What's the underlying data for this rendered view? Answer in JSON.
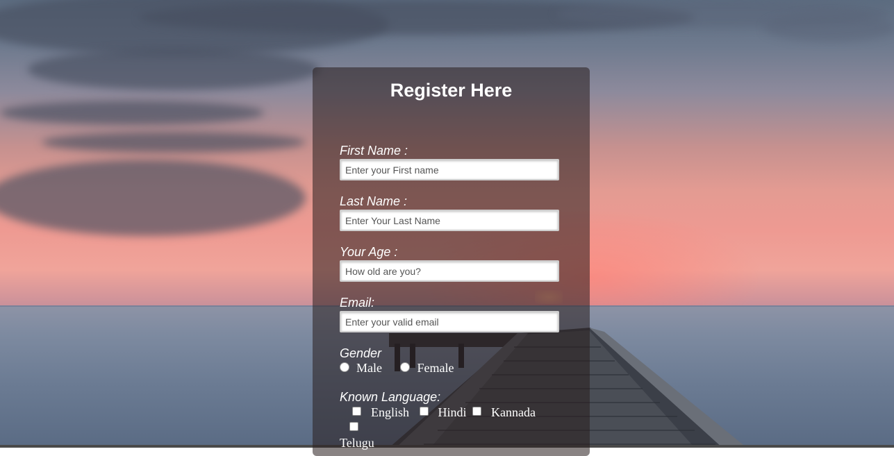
{
  "form": {
    "title": "Register Here",
    "first_name": {
      "label": "First Name :",
      "placeholder": "Enter your First name"
    },
    "last_name": {
      "label": "Last Name :",
      "placeholder": "Enter Your Last Name"
    },
    "age": {
      "label": "Your Age :",
      "placeholder": "How old are you?"
    },
    "email": {
      "label": "Email:",
      "placeholder": "Enter your valid email"
    },
    "gender": {
      "label": "Gender",
      "options": [
        "Male",
        "Female"
      ]
    },
    "languages": {
      "label": "Known Language:",
      "options": [
        "English",
        "Hindi",
        "Kannada",
        "Telugu"
      ]
    }
  }
}
